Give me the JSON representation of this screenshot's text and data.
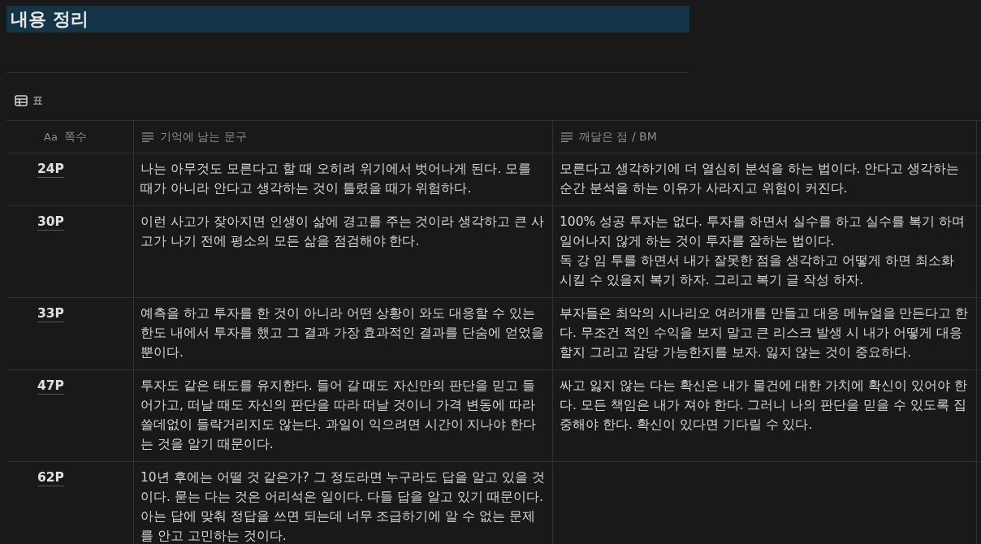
{
  "heading": "내용 정리",
  "view_tab": {
    "label": "표"
  },
  "table": {
    "columns": [
      {
        "kind": "title",
        "icon_text": "Aa",
        "label": "쪽수"
      },
      {
        "kind": "text",
        "label": "기억에 남는 문구"
      },
      {
        "kind": "text",
        "label": "깨달은 점 / BM"
      }
    ],
    "rows": [
      {
        "page": "24P",
        "quote": "나는 아무것도 모른다고 할 때 오히려 위기에서 벗어나게 된다. 모를 때가 아니라 안다고 생각하는 것이 틀렸을 때가 위험하다.",
        "insight": "모른다고 생각하기에 더 열심히 분석을 하는 법이다. 안다고 생각하는 순간 분석을 하는 이유가 사라지고 위험이 커진다."
      },
      {
        "page": "30P",
        "quote": "이런 사고가 잦아지면 인생이 삶에 경고를 주는 것이라 생각하고 큰 사고가 나기 전에 평소의 모든 삶을 점검해야 한다.",
        "insight": "100% 성공 투자는 없다. 투자를 하면서 실수를 하고 실수를 복기 하며 일어나지 않게 하는 것이 투자를 잘하는 법이다.\n독 강 임 투를 하면서 내가 잘못한 점을 생각하고 어떻게 하면 최소화 시킬 수 있을지 복기 하자. 그리고 복기 글 작성 하자."
      },
      {
        "page": "33P",
        "quote": "예측을 하고 투자를 한 것이 아니라 어떤 상황이 와도 대응할 수 있는 한도 내에서 투자를 했고 그 결과 가장 효과적인 결과를 단숨에 얻었을 뿐이다.",
        "insight": "부자들은 최악의 시나리오 여러개를 만들고 대응 메뉴얼을 만든다고 한다. 무조건 적인 수익을 보지 말고 큰 리스크 발생 시 내가 어떻게 대응 할지 그리고 감당 가능한지를 보자. 잃지 않는 것이 중요하다."
      },
      {
        "page": "47P",
        "quote": "투자도 같은 태도를 유지한다. 들어 갈 때도 자신만의 판단을 믿고 들어가고, 떠날 때도 자신의 판단을 따라 떠날 것이니 가격 변동에 따라 쓸데없이 들락거리지도 않는다. 과일이 익으려면 시간이 지나야 한다는 것을 알기 때문이다.",
        "insight": "싸고 잃지 않는 다는 확신은 내가 물건에 대한 가치에 확신이 있어야 한다. 모든 책임은 내가 져야 한다. 그러니 나의 판단을 믿을 수 있도록 집중해야 한다. 확신이 있다면 기다릴 수 있다."
      },
      {
        "page": "62P",
        "quote": "10년 후에는 어떨 것 같은가? 그 정도라면 누구라도 답을 알고 있을 것이다. 묻는 다는 것은 어리석은 일이다. 다들 답을 알고 있기 때문이다. 아는 답에 맞춰 정답을 쓰면 되는데 너무 조급하기에 알 수 없는 문제를 안고 고민하는 것이다."
      }
    ]
  }
}
